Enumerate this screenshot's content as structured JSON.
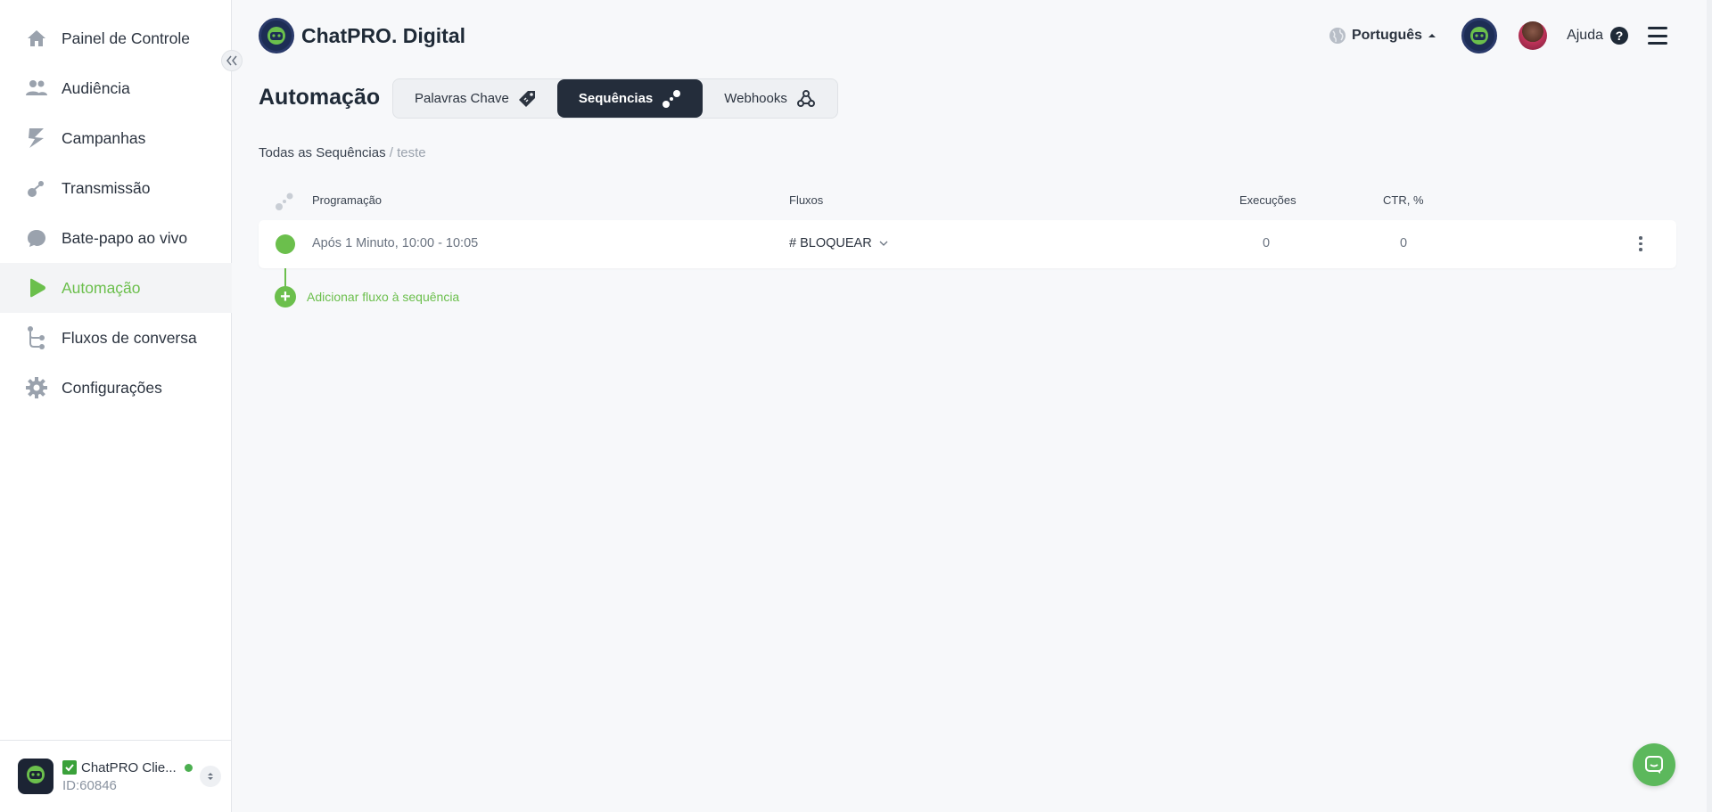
{
  "sidebar": {
    "items": [
      {
        "label": "Painel de Controle",
        "icon": "home-icon"
      },
      {
        "label": "Audiência",
        "icon": "users-icon"
      },
      {
        "label": "Campanhas",
        "icon": "megaphone-icon"
      },
      {
        "label": "Transmissão",
        "icon": "broadcast-icon"
      },
      {
        "label": "Bate-papo ao vivo",
        "icon": "chat-bubble-icon"
      },
      {
        "label": "Automação",
        "icon": "play-icon"
      },
      {
        "label": "Fluxos de conversa",
        "icon": "flow-icon"
      },
      {
        "label": "Configurações",
        "icon": "gear-icon"
      }
    ],
    "active_index": 5,
    "account": {
      "name": "ChatPRO Clie...",
      "id": "ID:60846",
      "status_color": "#4caf50"
    }
  },
  "header": {
    "brand": "ChatPRO. Digital",
    "language": "Português",
    "help": "Ajuda"
  },
  "page": {
    "title": "Automação",
    "tabs": [
      {
        "label": "Palavras Chave",
        "icon": "tag-icon"
      },
      {
        "label": "Sequências",
        "icon": "sequence-icon"
      },
      {
        "label": "Webhooks",
        "icon": "webhook-icon"
      }
    ],
    "active_tab": 1
  },
  "breadcrumb": {
    "root": "Todas as Sequências",
    "separator": "/",
    "current": "teste"
  },
  "table": {
    "headers": {
      "schedule": "Programação",
      "flows": "Fluxos",
      "executions": "Execuções",
      "ctr": "CTR, %"
    },
    "rows": [
      {
        "schedule": "Após 1 Minuto, 10:00 - 10:05",
        "flow": "# BLOQUEAR",
        "executions": "0",
        "ctr": "0",
        "enabled": true
      }
    ],
    "add_label": "Adicionar fluxo à sequência"
  },
  "colors": {
    "accent_green": "#6bbf4c",
    "dark": "#242d3b",
    "toggle_blue": "#1a7fe0"
  }
}
